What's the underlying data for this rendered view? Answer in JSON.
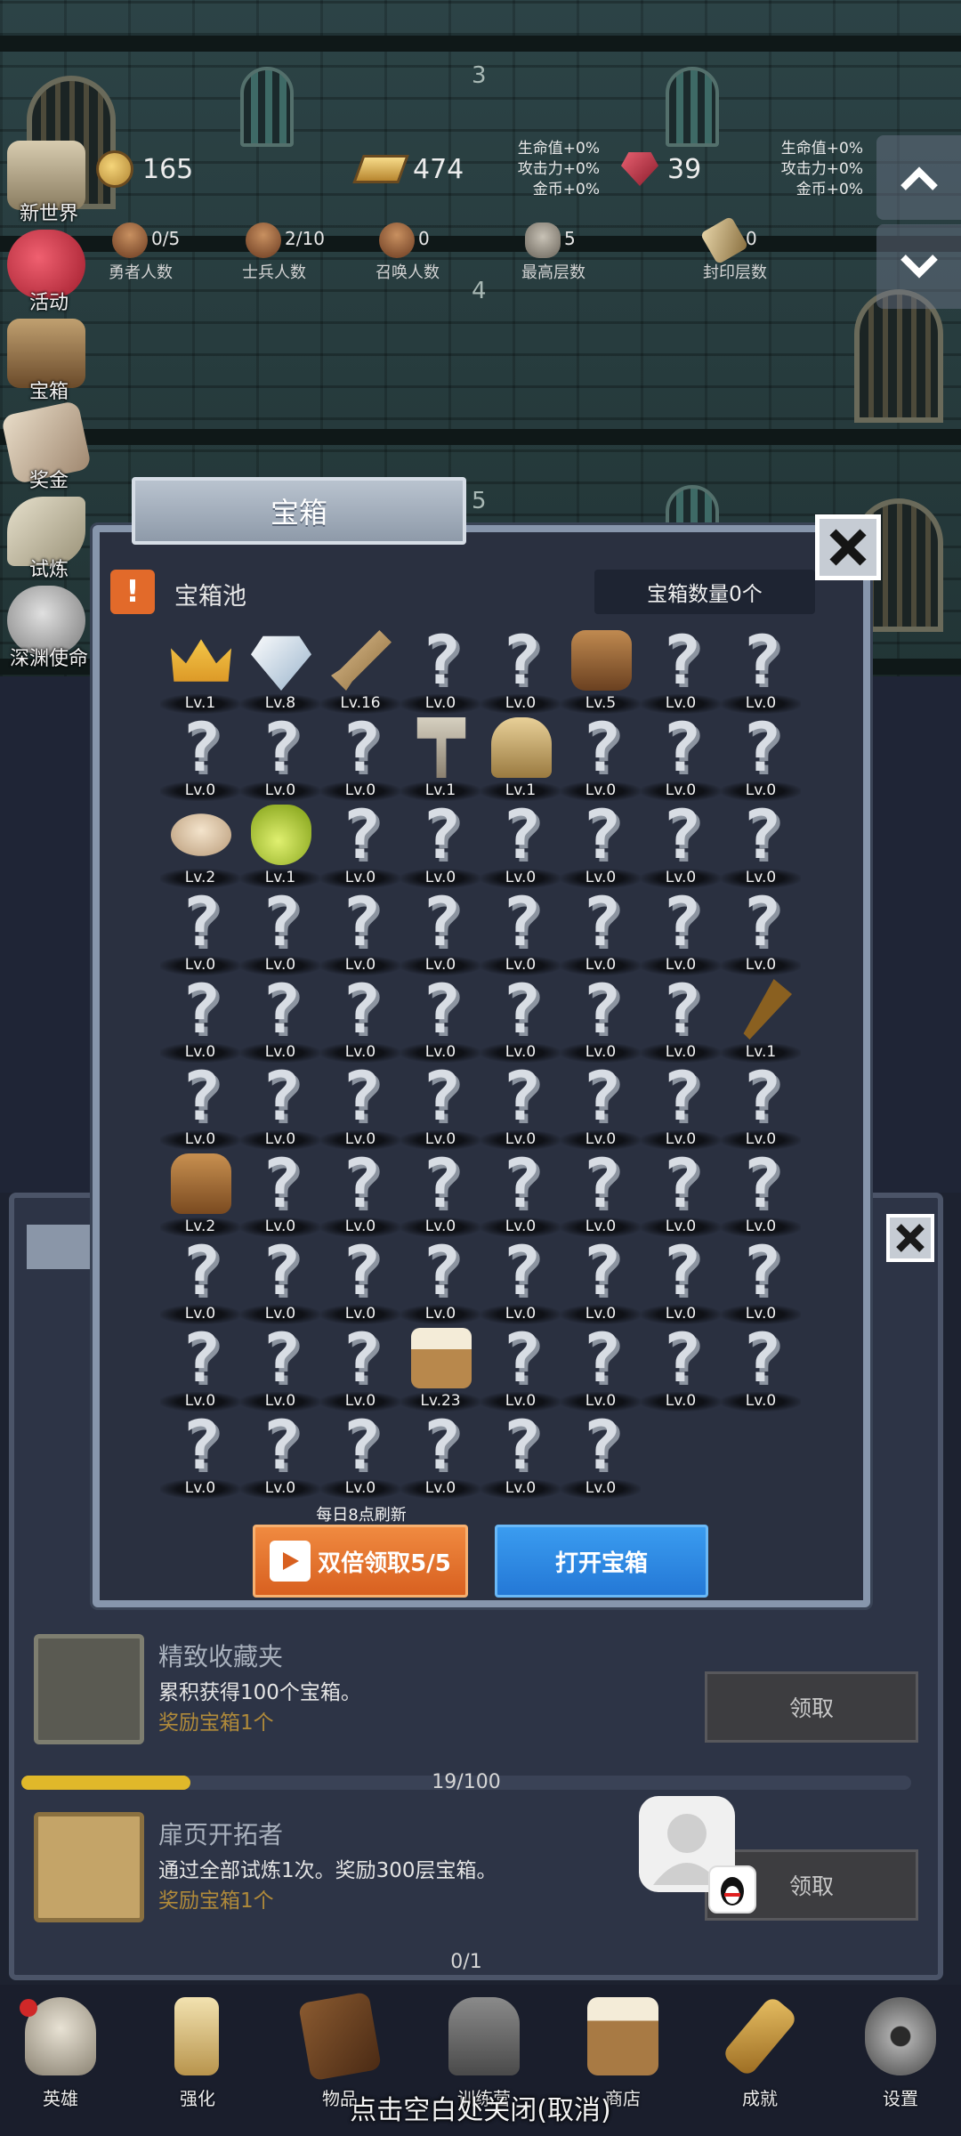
{
  "floors": [
    "3",
    "4",
    "5"
  ],
  "hud": {
    "gold": "165",
    "gold_bar": "474",
    "ruby": "39",
    "bonus_1": [
      "生命值+0%",
      "攻击力+0%",
      "金币+0%"
    ],
    "bonus_2": [
      "生命值+0%",
      "攻击力+0%",
      "金币+0%"
    ]
  },
  "stats": [
    {
      "value": "0/5",
      "label": "勇者人数"
    },
    {
      "value": "2/10",
      "label": "士兵人数"
    },
    {
      "value": "0",
      "label": "召唤人数"
    },
    {
      "value": "5",
      "label": "最高层数"
    },
    {
      "value": "0",
      "label": "封印层数"
    }
  ],
  "side_menu": [
    "新世界",
    "活动",
    "宝箱",
    "奖金",
    "试炼",
    "深渊使命"
  ],
  "popup": {
    "tab_title": "宝箱",
    "pool_title": "宝箱池",
    "pool_count": "宝箱数量0个",
    "refresh_note": "每日8点刷新",
    "double_button": "双倍领取5/5",
    "open_button": "打开宝箱",
    "items": [
      {
        "icon": "crown",
        "level": "Lv.1"
      },
      {
        "icon": "diamond",
        "level": "Lv.8"
      },
      {
        "icon": "sword",
        "level": "Lv.16"
      },
      {
        "icon": "unknown",
        "level": "Lv.0"
      },
      {
        "icon": "unknown",
        "level": "Lv.0"
      },
      {
        "icon": "backpack",
        "level": "Lv.5"
      },
      {
        "icon": "unknown",
        "level": "Lv.0"
      },
      {
        "icon": "unknown",
        "level": "Lv.0"
      },
      {
        "icon": "unknown",
        "level": "Lv.0"
      },
      {
        "icon": "unknown",
        "level": "Lv.0"
      },
      {
        "icon": "unknown",
        "level": "Lv.0"
      },
      {
        "icon": "hammer",
        "level": "Lv.1"
      },
      {
        "icon": "knight-helmet",
        "level": "Lv.1"
      },
      {
        "icon": "unknown",
        "level": "Lv.0"
      },
      {
        "icon": "unknown",
        "level": "Lv.0"
      },
      {
        "icon": "unknown",
        "level": "Lv.0"
      },
      {
        "icon": "bread",
        "level": "Lv.2"
      },
      {
        "icon": "potion",
        "level": "Lv.1"
      },
      {
        "icon": "unknown",
        "level": "Lv.0"
      },
      {
        "icon": "unknown",
        "level": "Lv.0"
      },
      {
        "icon": "unknown",
        "level": "Lv.0"
      },
      {
        "icon": "unknown",
        "level": "Lv.0"
      },
      {
        "icon": "unknown",
        "level": "Lv.0"
      },
      {
        "icon": "unknown",
        "level": "Lv.0"
      },
      {
        "icon": "unknown",
        "level": "Lv.0"
      },
      {
        "icon": "unknown",
        "level": "Lv.0"
      },
      {
        "icon": "unknown",
        "level": "Lv.0"
      },
      {
        "icon": "unknown",
        "level": "Lv.0"
      },
      {
        "icon": "unknown",
        "level": "Lv.0"
      },
      {
        "icon": "unknown",
        "level": "Lv.0"
      },
      {
        "icon": "unknown",
        "level": "Lv.0"
      },
      {
        "icon": "unknown",
        "level": "Lv.0"
      },
      {
        "icon": "unknown",
        "level": "Lv.0"
      },
      {
        "icon": "unknown",
        "level": "Lv.0"
      },
      {
        "icon": "unknown",
        "level": "Lv.0"
      },
      {
        "icon": "unknown",
        "level": "Lv.0"
      },
      {
        "icon": "unknown",
        "level": "Lv.0"
      },
      {
        "icon": "unknown",
        "level": "Lv.0"
      },
      {
        "icon": "unknown",
        "level": "Lv.0"
      },
      {
        "icon": "torch",
        "level": "Lv.1"
      },
      {
        "icon": "unknown",
        "level": "Lv.0"
      },
      {
        "icon": "unknown",
        "level": "Lv.0"
      },
      {
        "icon": "unknown",
        "level": "Lv.0"
      },
      {
        "icon": "unknown",
        "level": "Lv.0"
      },
      {
        "icon": "unknown",
        "level": "Lv.0"
      },
      {
        "icon": "unknown",
        "level": "Lv.0"
      },
      {
        "icon": "unknown",
        "level": "Lv.0"
      },
      {
        "icon": "unknown",
        "level": "Lv.0"
      },
      {
        "icon": "leather-bag",
        "level": "Lv.2"
      },
      {
        "icon": "unknown",
        "level": "Lv.0"
      },
      {
        "icon": "unknown",
        "level": "Lv.0"
      },
      {
        "icon": "unknown",
        "level": "Lv.0"
      },
      {
        "icon": "unknown",
        "level": "Lv.0"
      },
      {
        "icon": "unknown",
        "level": "Lv.0"
      },
      {
        "icon": "unknown",
        "level": "Lv.0"
      },
      {
        "icon": "unknown",
        "level": "Lv.0"
      },
      {
        "icon": "unknown",
        "level": "Lv.0"
      },
      {
        "icon": "unknown",
        "level": "Lv.0"
      },
      {
        "icon": "unknown",
        "level": "Lv.0"
      },
      {
        "icon": "unknown",
        "level": "Lv.0"
      },
      {
        "icon": "unknown",
        "level": "Lv.0"
      },
      {
        "icon": "unknown",
        "level": "Lv.0"
      },
      {
        "icon": "unknown",
        "level": "Lv.0"
      },
      {
        "icon": "unknown",
        "level": "Lv.0"
      },
      {
        "icon": "unknown",
        "level": "Lv.0"
      },
      {
        "icon": "unknown",
        "level": "Lv.0"
      },
      {
        "icon": "unknown",
        "level": "Lv.0"
      },
      {
        "icon": "beer-mug",
        "level": "Lv.23"
      },
      {
        "icon": "unknown",
        "level": "Lv.0"
      },
      {
        "icon": "unknown",
        "level": "Lv.0"
      },
      {
        "icon": "unknown",
        "level": "Lv.0"
      },
      {
        "icon": "unknown",
        "level": "Lv.0"
      },
      {
        "icon": "unknown",
        "level": "Lv.0"
      },
      {
        "icon": "unknown",
        "level": "Lv.0"
      },
      {
        "icon": "unknown",
        "level": "Lv.0"
      },
      {
        "icon": "unknown",
        "level": "Lv.0"
      },
      {
        "icon": "unknown",
        "level": "Lv.0"
      },
      {
        "icon": "unknown",
        "level": "Lv.0"
      }
    ]
  },
  "quests": [
    {
      "title": "精致收藏夹",
      "desc": "累积获得100个宝箱。",
      "reward": "奖励宝箱1个",
      "claim": "领取",
      "progress_text": "19/100",
      "progress": 0.19
    },
    {
      "title": "扉页开拓者",
      "desc": "通过全部试炼1次。奖励300层宝箱。",
      "reward": "奖励宝箱1个",
      "claim": "领取",
      "progress_text": "0/1",
      "progress": 0.0
    }
  ],
  "bottom_nav": [
    "英雄",
    "强化",
    "物品",
    "训练营",
    "商店",
    "成就",
    "设置"
  ],
  "close_hint": "点击空白处关闭(取消)"
}
